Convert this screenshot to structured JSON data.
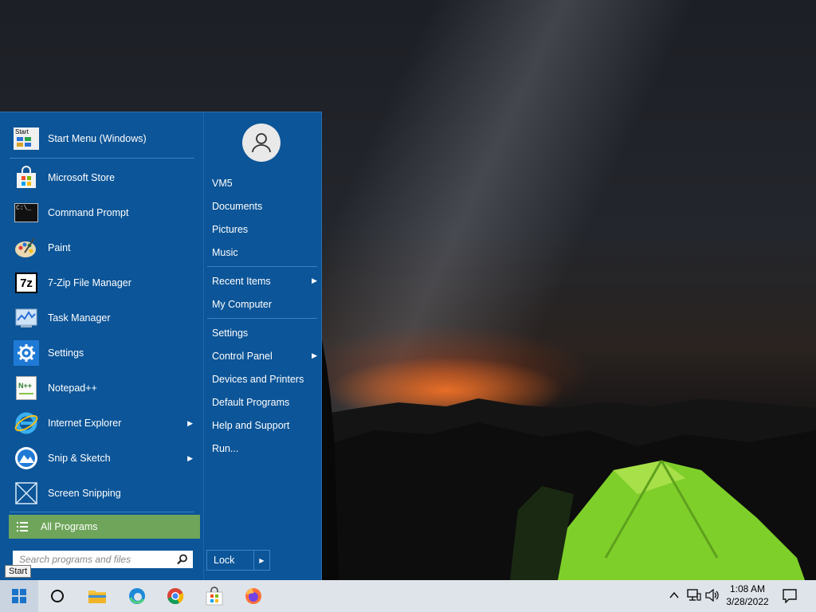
{
  "start_menu": {
    "programs": [
      {
        "label": "Start Menu (Windows)",
        "icon": "start-menu-app-icon"
      },
      {
        "label": "Microsoft Store",
        "icon": "store-bag-icon"
      },
      {
        "label": "Command Prompt",
        "icon": "command-prompt-icon"
      },
      {
        "label": "Paint",
        "icon": "paint-palette-icon"
      },
      {
        "label": "7-Zip File Manager",
        "icon": "7zip-icon"
      },
      {
        "label": "Task Manager",
        "icon": "task-manager-icon"
      },
      {
        "label": "Settings",
        "icon": "gear-icon"
      },
      {
        "label": "Notepad++",
        "icon": "notepad-plus-icon"
      },
      {
        "label": "Internet Explorer",
        "icon": "internet-explorer-icon"
      },
      {
        "label": "Snip & Sketch",
        "icon": "snip-sketch-icon"
      },
      {
        "label": "Screen Snipping",
        "icon": "screen-snipping-icon"
      }
    ],
    "start_icon_text": "Start",
    "cmd_icon_text": "C:\\_",
    "zip_icon_text": "7z",
    "notepad_icon_text": "N++",
    "all_programs": "All Programs",
    "search_placeholder": "Search programs and files",
    "right_items": {
      "vm5": "VM5",
      "documents": "Documents",
      "pictures": "Pictures",
      "music": "Music",
      "recent_items": "Recent Items",
      "my_computer": "My Computer",
      "settings": "Settings",
      "control_panel": "Control Panel",
      "devices_printers": "Devices and Printers",
      "default_programs": "Default Programs",
      "help_support": "Help and Support",
      "run": "Run..."
    },
    "lock": "Lock",
    "submenu_arrow": "▶"
  },
  "tooltip": "Start",
  "taskbar": {
    "time": "1:08 AM",
    "date": "3/28/2022"
  },
  "colors": {
    "menu_bg": "#0c5598",
    "all_programs_bg": "#6ea55a",
    "taskbar_bg": "#dfe4ea"
  }
}
